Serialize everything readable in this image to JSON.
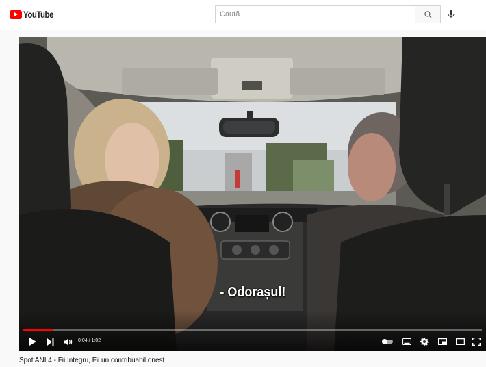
{
  "header": {
    "logo_text": "YouTube",
    "search_placeholder": "Caută"
  },
  "player": {
    "caption": "- Odorașul!",
    "time_display": "0:04 / 1:02",
    "progress": 0.065
  },
  "video": {
    "title": "Spot ANI 4 - Fii Integru, Fii un contribuabil onest"
  },
  "colors": {
    "brand_red": "#ff0000",
    "page_bg": "#f9f9f9"
  }
}
